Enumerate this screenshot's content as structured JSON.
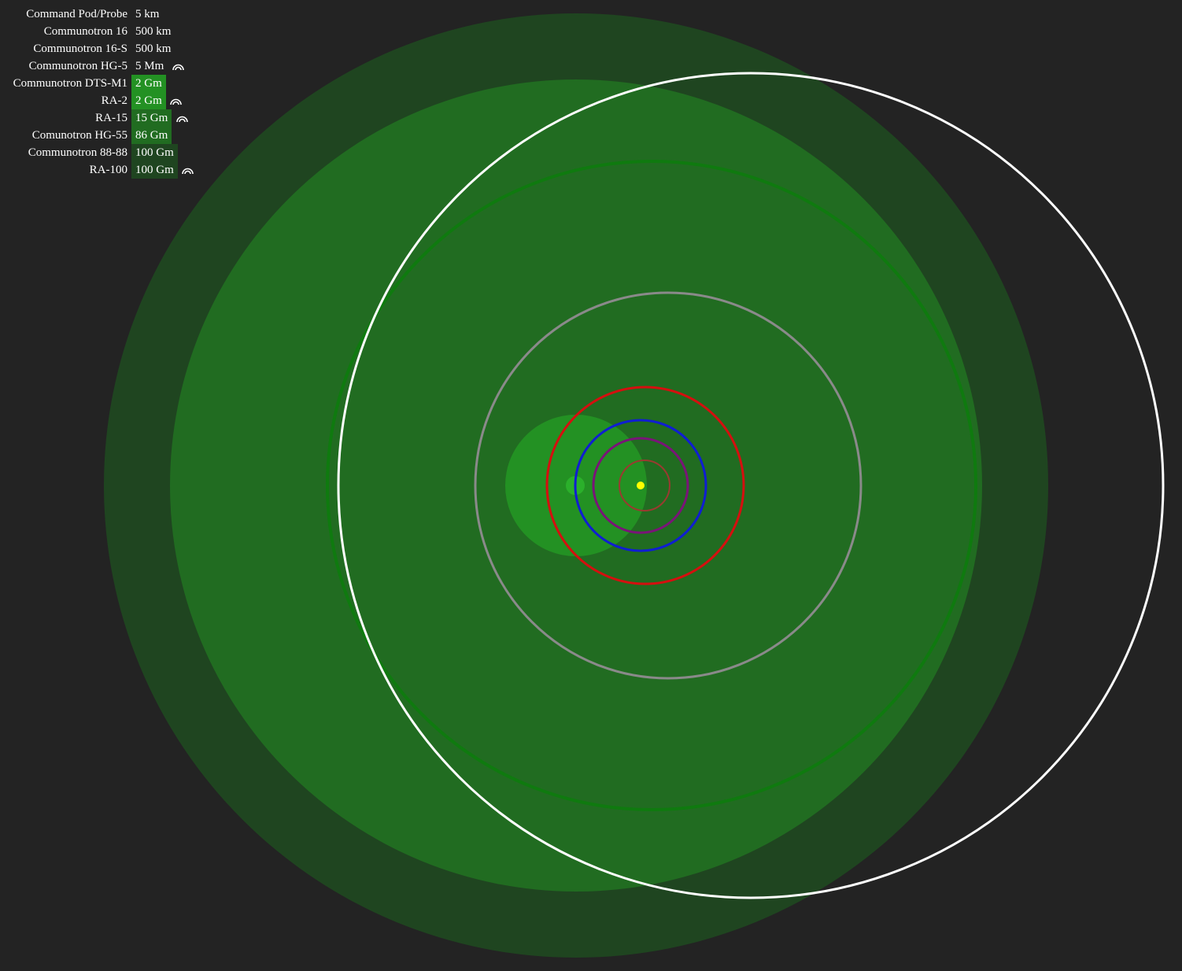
{
  "colors": {
    "background": "#232323",
    "ring_green_dark": "#1f4520",
    "ring_green_mid": "#216c21",
    "ring_green_bright": "#239123",
    "relay_orbit": "#ffffff",
    "orbit_green": "#0f7a0f",
    "orbit_grey": "#8a8a8a",
    "orbit_red": "#d50f0f",
    "orbit_blue": "#0f1ed2",
    "orbit_purple": "#7a1478",
    "orbit_brown": "#9a3a30",
    "sun": "#ffff00"
  },
  "antennas": [
    {
      "name": "Command Pod/Probe",
      "range": "5 km",
      "relay": false,
      "highlight": "none"
    },
    {
      "name": "Communotron 16",
      "range": "500 km",
      "relay": false,
      "highlight": "none"
    },
    {
      "name": "Communotron 16-S",
      "range": "500 km",
      "relay": false,
      "highlight": "none"
    },
    {
      "name": "Communotron HG-5",
      "range": "5 Mm",
      "relay": true,
      "highlight": "none"
    },
    {
      "name": "Communotron DTS-M1",
      "range": "2 Gm",
      "relay": false,
      "highlight": "bright"
    },
    {
      "name": "RA-2",
      "range": "2 Gm",
      "relay": true,
      "highlight": "bright"
    },
    {
      "name": "RA-15",
      "range": "15 Gm",
      "relay": true,
      "highlight": "mid"
    },
    {
      "name": "Comunotron HG-55",
      "range": "86 Gm",
      "relay": false,
      "highlight": "mid"
    },
    {
      "name": "Communotron 88-88",
      "range": "100 Gm",
      "relay": false,
      "highlight": "dark"
    },
    {
      "name": "RA-100",
      "range": "100 Gm",
      "relay": true,
      "highlight": "dark"
    }
  ],
  "relay_icon": "relay-antenna-icon"
}
